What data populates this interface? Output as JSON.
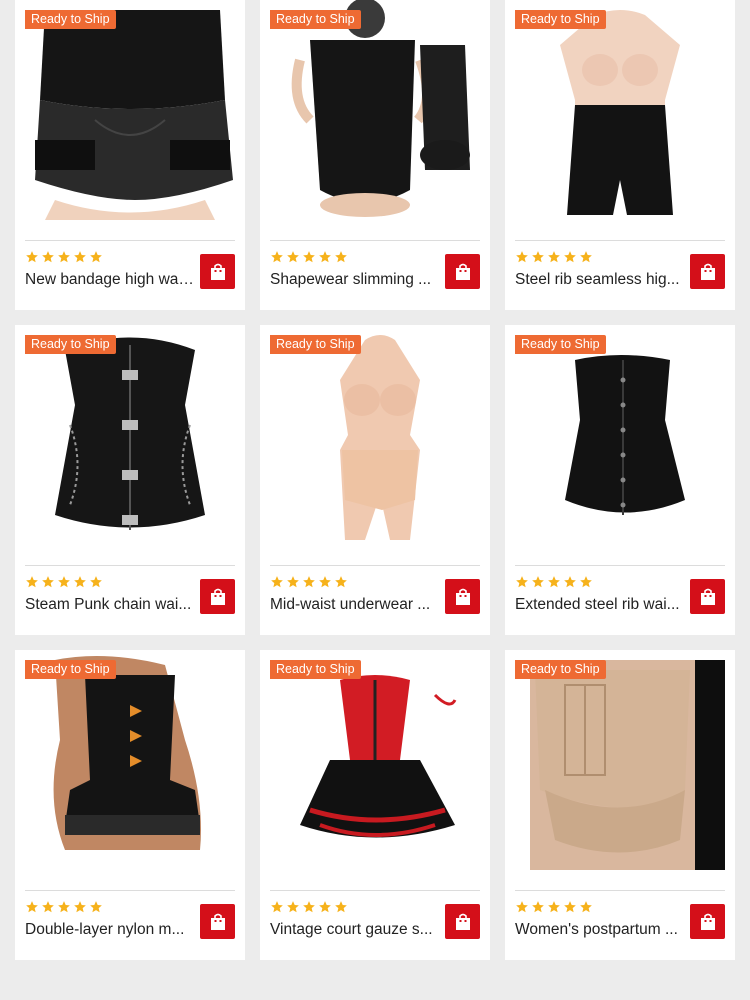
{
  "badge_label": "Ready to Ship",
  "rating_stars": 5,
  "colors": {
    "badge": "#ee6a33",
    "star": "#f6b21b",
    "cart": "#d40f19"
  },
  "products": [
    {
      "title": "New bandage high waist..."
    },
    {
      "title": "Shapewear slimming ..."
    },
    {
      "title": "Steel rib seamless hig..."
    },
    {
      "title": "Steam Punk chain wai..."
    },
    {
      "title": "Mid-waist underwear ..."
    },
    {
      "title": "Extended steel rib wai..."
    },
    {
      "title": "Double-layer nylon m..."
    },
    {
      "title": "Vintage court gauze s..."
    },
    {
      "title": "Women's postpartum ..."
    }
  ]
}
